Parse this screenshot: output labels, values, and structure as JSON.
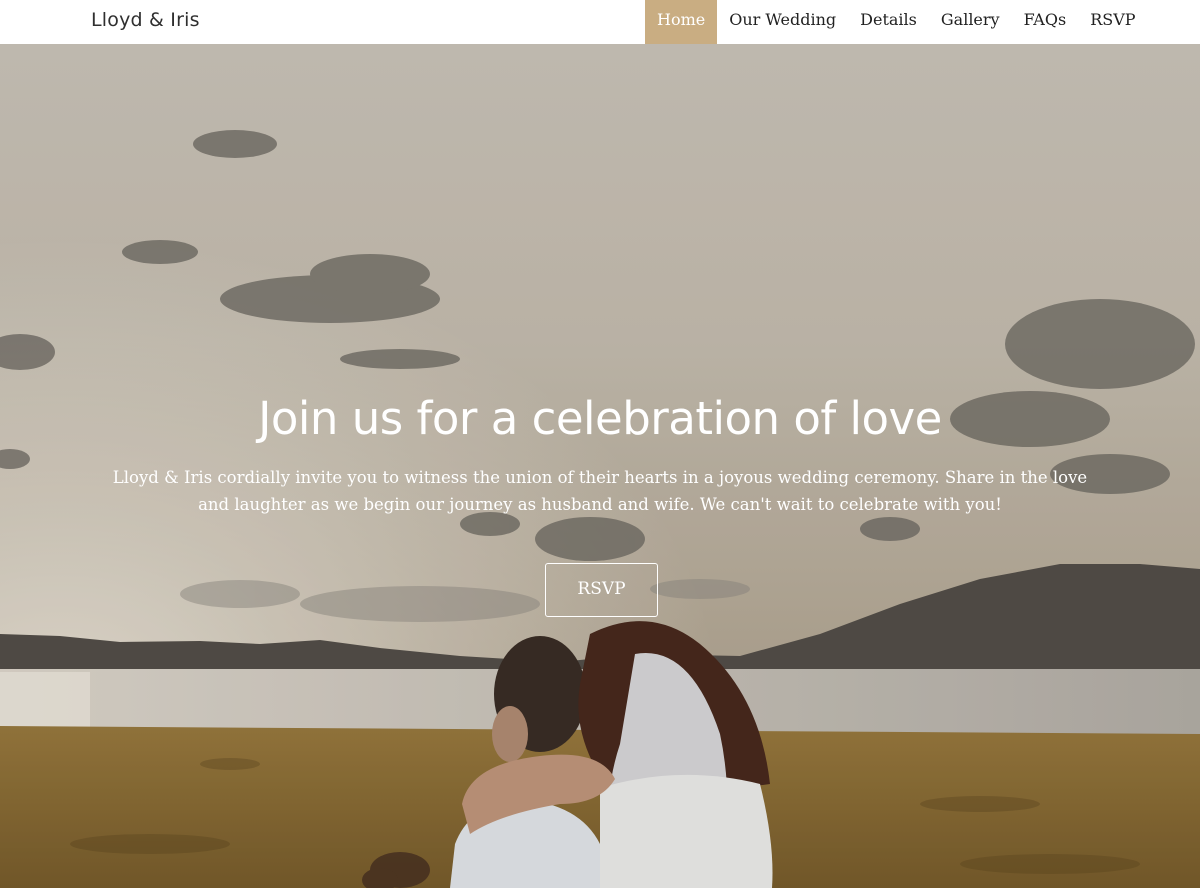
{
  "header": {
    "brand": "Lloyd & Iris",
    "nav": [
      {
        "label": "Home",
        "active": true
      },
      {
        "label": "Our Wedding"
      },
      {
        "label": "Details"
      },
      {
        "label": "Gallery"
      },
      {
        "label": "FAQs"
      },
      {
        "label": "RSVP"
      }
    ]
  },
  "hero": {
    "title": "Join us for a celebration of love",
    "text": "Lloyd & Iris cordially invite you to witness the union of their hearts in a joyous wedding ceremony. Share in the love and laughter as we begin our journey as husband and wife. We can't wait to celebrate with you!",
    "button": "RSVP",
    "image": "couple-by-lake-photo"
  },
  "colors": {
    "accent": "#c9ad82",
    "header_bg": "#ffffff"
  }
}
